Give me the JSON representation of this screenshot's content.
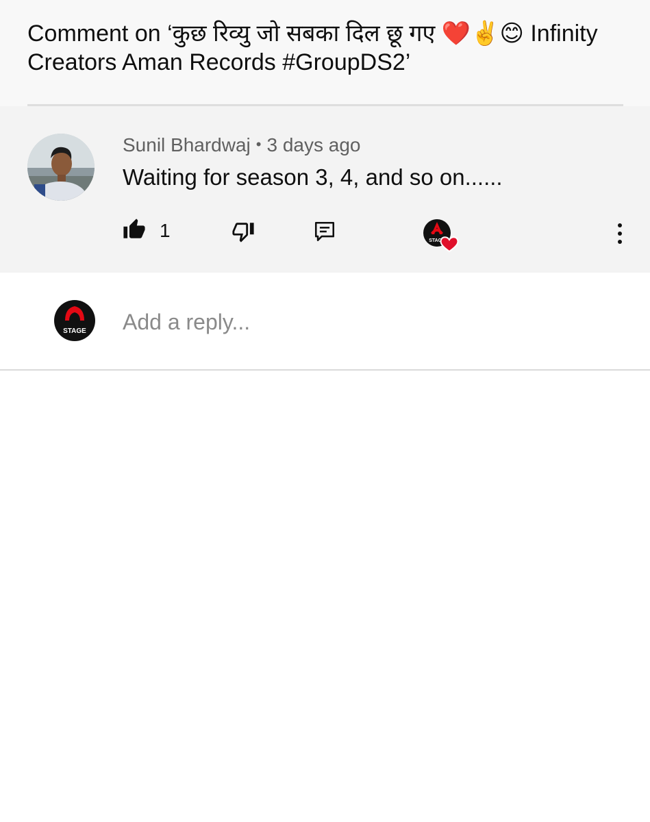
{
  "header": {
    "title": "Comment on ‘कुछ रिव्यु जो सबका दिल छू गए ❤️✌️😊 Infinity Creators Aman Records #GroupDS2’"
  },
  "comment": {
    "author": "Sunil Bhardwaj",
    "separator": "•",
    "timestamp": "3 days ago",
    "text": "Waiting for season 3, 4, and so on......",
    "like_count": "1"
  },
  "channel_logo_text": "STAGE",
  "reply": {
    "placeholder": "Add a reply..."
  },
  "colors": {
    "header_bg": "#f8f8f8",
    "comment_bg": "#f3f3f3",
    "brand_red": "#e50914",
    "heart_red": "#e0102b"
  },
  "icons": {
    "like": "thumbs-up-icon",
    "dislike": "thumbs-down-icon",
    "reply": "reply-icon",
    "creator_heart": "creator-heart-icon",
    "more": "more-vert-icon"
  }
}
